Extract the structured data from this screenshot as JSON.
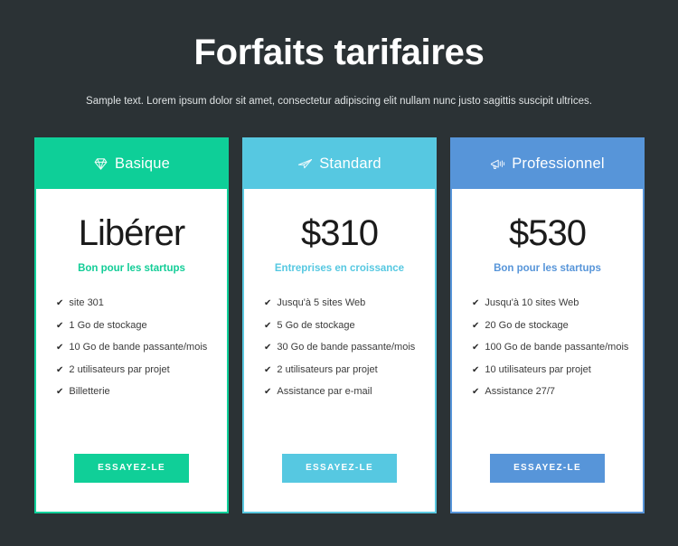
{
  "header": {
    "title": "Forfaits tarifaires",
    "subtitle": "Sample text. Lorem ipsum dolor sit amet, consectetur adipiscing elit nullam nunc justo sagittis suscipit ultrices."
  },
  "colors": {
    "background": "#2b3235",
    "basique": "#0ecf98",
    "standard": "#56c8e1",
    "professionnel": "#5795d9",
    "title_text": "#ffffff",
    "price_text": "#1b1b1b",
    "feature_text": "#3b3b3b"
  },
  "plans": [
    {
      "id": "basique",
      "icon": "diamond-icon",
      "name": "Basique",
      "price": "Libérer",
      "note": "Bon pour les startups",
      "features": [
        "site 301",
        "1 Go de stockage",
        "10 Go de bande passante/mois",
        "2 utilisateurs par projet",
        "Billetterie"
      ],
      "cta": "ESSAYEZ-LE"
    },
    {
      "id": "standard",
      "icon": "paper-plane-icon",
      "name": "Standard",
      "price": "$310",
      "note": "Entreprises en croissance",
      "features": [
        "Jusqu'à 5 sites Web",
        "5 Go de stockage",
        "30 Go de bande passante/mois",
        "2 utilisateurs par projet",
        "Assistance par e-mail"
      ],
      "cta": "ESSAYEZ-LE"
    },
    {
      "id": "professionnel",
      "icon": "megaphone-icon",
      "name": "Professionnel",
      "price": "$530",
      "note": "Bon pour les startups",
      "features": [
        "Jusqu'à 10 sites Web",
        "20 Go de stockage",
        "100 Go de bande passante/mois",
        "10 utilisateurs par projet",
        "Assistance 27/7"
      ],
      "cta": "ESSAYEZ-LE"
    }
  ],
  "check_glyph": "✔"
}
